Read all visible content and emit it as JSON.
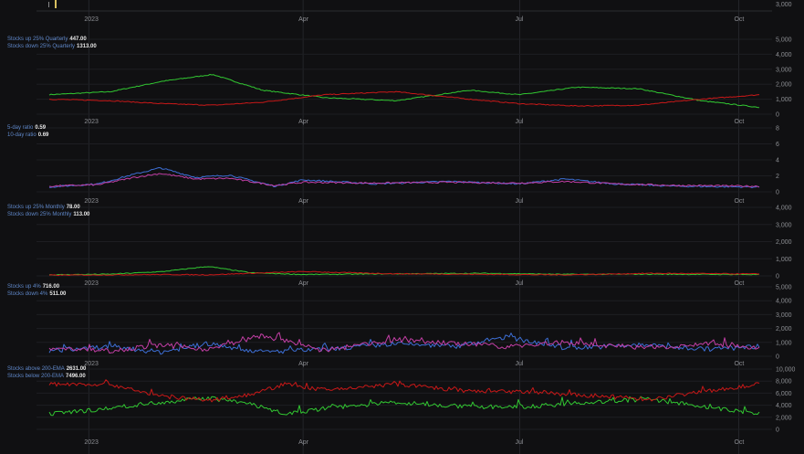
{
  "colors": {
    "background": "#101012",
    "grid": "#1d1e22",
    "axis_text": "#8d8f94",
    "label_name": "#5f87c8",
    "value_text": "#e6e6e6",
    "green": "#32c832",
    "red": "#c81818",
    "blue": "#3d6fd6",
    "magenta": "#c43fa6"
  },
  "x_axis": {
    "ticks": [
      {
        "x": "2023-01-01",
        "label": "2023"
      },
      {
        "x": "2023-04-01",
        "label": "Apr"
      },
      {
        "x": "2023-07-01",
        "label": "Jul"
      },
      {
        "x": "2023-10-01",
        "label": "Oct"
      }
    ]
  },
  "top_strip": {
    "tick_label": "3,000"
  },
  "chart_data": [
    {
      "type": "line",
      "ylim": [
        0,
        5000
      ],
      "yticks": [
        0,
        1000,
        2000,
        3000,
        4000,
        5000
      ],
      "ytick_labels": [
        "0",
        "1,000",
        "2,000",
        "3,000",
        "4,000",
        "5,000"
      ],
      "series": [
        {
          "name": "Stocks up 25% Quarterly",
          "last": "447.00",
          "color": "#32c832",
          "x": [
            "2022-12-15",
            "2023-01-10",
            "2023-02-01",
            "2023-02-22",
            "2023-03-15",
            "2023-04-10",
            "2023-05-10",
            "2023-06-10",
            "2023-07-01",
            "2023-07-25",
            "2023-08-20",
            "2023-09-15",
            "2023-10-10"
          ],
          "values": [
            1300,
            1500,
            2200,
            2650,
            1600,
            1100,
            900,
            1600,
            1300,
            1800,
            1700,
            900,
            450
          ]
        },
        {
          "name": "Stocks down 25% Quarterly",
          "last": "1313.00",
          "color": "#c81818",
          "x": [
            "2022-12-15",
            "2023-01-10",
            "2023-02-01",
            "2023-02-22",
            "2023-03-15",
            "2023-04-10",
            "2023-05-10",
            "2023-06-10",
            "2023-07-01",
            "2023-07-25",
            "2023-08-20",
            "2023-09-15",
            "2023-10-10"
          ],
          "values": [
            1000,
            900,
            700,
            600,
            800,
            1300,
            1500,
            1000,
            700,
            550,
            600,
            1000,
            1300
          ]
        }
      ]
    },
    {
      "type": "line",
      "ylim": [
        0,
        8
      ],
      "yticks": [
        0,
        2,
        4,
        6,
        8
      ],
      "ytick_labels": [
        "0",
        "2",
        "4",
        "6",
        "8"
      ],
      "series": [
        {
          "name": "5-day ratio",
          "last": "0.59",
          "color": "#3d6fd6",
          "x": [
            "2022-12-15",
            "2023-01-05",
            "2023-01-20",
            "2023-01-31",
            "2023-02-15",
            "2023-03-01",
            "2023-03-20",
            "2023-04-01",
            "2023-05-01",
            "2023-06-01",
            "2023-07-01",
            "2023-07-20",
            "2023-08-10",
            "2023-09-05",
            "2023-10-10"
          ],
          "values": [
            0.6,
            1.0,
            2.2,
            3.0,
            1.8,
            2.1,
            0.7,
            1.5,
            1.0,
            1.3,
            1.0,
            1.6,
            1.0,
            0.7,
            0.6
          ]
        },
        {
          "name": "10-day ratio",
          "last": "0.69",
          "color": "#c43fa6",
          "x": [
            "2022-12-15",
            "2023-01-05",
            "2023-01-20",
            "2023-01-31",
            "2023-02-15",
            "2023-03-01",
            "2023-03-20",
            "2023-04-01",
            "2023-05-01",
            "2023-06-01",
            "2023-07-01",
            "2023-07-20",
            "2023-08-10",
            "2023-09-05",
            "2023-10-10"
          ],
          "values": [
            0.7,
            0.9,
            1.8,
            2.3,
            1.6,
            1.7,
            0.8,
            1.2,
            1.1,
            1.2,
            1.1,
            1.3,
            1.0,
            0.8,
            0.7
          ]
        }
      ]
    },
    {
      "type": "line",
      "ylim": [
        0,
        4000
      ],
      "yticks": [
        0,
        1000,
        2000,
        3000,
        4000
      ],
      "ytick_labels": [
        "0",
        "1,000",
        "2,000",
        "3,000",
        "4,000"
      ],
      "series": [
        {
          "name": "Stocks up 25% Monthly",
          "last": "78.00",
          "color": "#32c832",
          "x": [
            "2022-12-15",
            "2023-01-10",
            "2023-02-01",
            "2023-02-20",
            "2023-03-10",
            "2023-04-01",
            "2023-05-10",
            "2023-06-15",
            "2023-07-20",
            "2023-08-25",
            "2023-10-10"
          ],
          "values": [
            60,
            100,
            250,
            550,
            180,
            80,
            120,
            150,
            90,
            100,
            78
          ]
        },
        {
          "name": "Stocks down 25% Monthly",
          "last": "113.00",
          "color": "#c81818",
          "x": [
            "2022-12-15",
            "2023-01-10",
            "2023-02-01",
            "2023-02-20",
            "2023-03-10",
            "2023-04-01",
            "2023-05-10",
            "2023-06-15",
            "2023-07-20",
            "2023-08-25",
            "2023-10-10"
          ],
          "values": [
            40,
            60,
            80,
            60,
            150,
            250,
            120,
            90,
            60,
            150,
            113
          ]
        }
      ]
    },
    {
      "type": "line",
      "ylim": [
        0,
        5000
      ],
      "yticks": [
        0,
        1000,
        2000,
        3000,
        4000,
        5000
      ],
      "ytick_labels": [
        "0",
        "1,000",
        "2,000",
        "3,000",
        "4,000",
        "5,000"
      ],
      "series": [
        {
          "name": "Stocks up 4%",
          "last": "716.00",
          "color": "#3d6fd6",
          "x": [
            "2022-12-15",
            "2023-01-10",
            "2023-01-31",
            "2023-02-20",
            "2023-03-15",
            "2023-04-10",
            "2023-05-10",
            "2023-06-05",
            "2023-06-25",
            "2023-07-20",
            "2023-08-20",
            "2023-09-20",
            "2023-10-10"
          ],
          "values": [
            400,
            700,
            300,
            900,
            300,
            500,
            900,
            700,
            1400,
            600,
            800,
            500,
            716
          ]
        },
        {
          "name": "Stocks down 4%",
          "last": "511.00",
          "color": "#c43fa6",
          "x": [
            "2022-12-15",
            "2023-01-10",
            "2023-01-31",
            "2023-02-20",
            "2023-03-15",
            "2023-04-10",
            "2023-05-10",
            "2023-06-05",
            "2023-06-25",
            "2023-07-20",
            "2023-08-20",
            "2023-09-20",
            "2023-10-10"
          ],
          "values": [
            600,
            400,
            800,
            500,
            1500,
            400,
            1200,
            900,
            700,
            1000,
            600,
            900,
            511
          ]
        }
      ]
    },
    {
      "type": "line",
      "ylim": [
        0,
        10000
      ],
      "yticks": [
        0,
        2000,
        4000,
        6000,
        8000,
        10000
      ],
      "ytick_labels": [
        "0",
        "2,000",
        "4,000",
        "6,000",
        "8,000",
        "10,000"
      ],
      "series": [
        {
          "name": "Stocks above 200-EMA",
          "last": "2631.00",
          "color": "#32c832",
          "x": [
            "2022-12-15",
            "2023-01-10",
            "2023-01-31",
            "2023-02-20",
            "2023-03-10",
            "2023-03-25",
            "2023-04-10",
            "2023-05-10",
            "2023-06-10",
            "2023-07-05",
            "2023-08-01",
            "2023-08-25",
            "2023-09-20",
            "2023-10-10"
          ],
          "values": [
            2500,
            3500,
            4500,
            5200,
            4200,
            2500,
            3500,
            4500,
            3700,
            3800,
            4500,
            5000,
            3500,
            2631
          ]
        },
        {
          "name": "Stocks below 200-EMA",
          "last": "7496.00",
          "color": "#c81818",
          "x": [
            "2022-12-15",
            "2023-01-10",
            "2023-01-31",
            "2023-02-20",
            "2023-03-10",
            "2023-03-25",
            "2023-04-10",
            "2023-05-10",
            "2023-06-10",
            "2023-07-05",
            "2023-08-01",
            "2023-08-25",
            "2023-09-20",
            "2023-10-10"
          ],
          "values": [
            7500,
            7500,
            5500,
            4800,
            5800,
            7500,
            6500,
            7500,
            6300,
            6200,
            5500,
            5000,
            6500,
            7496
          ]
        }
      ]
    }
  ]
}
